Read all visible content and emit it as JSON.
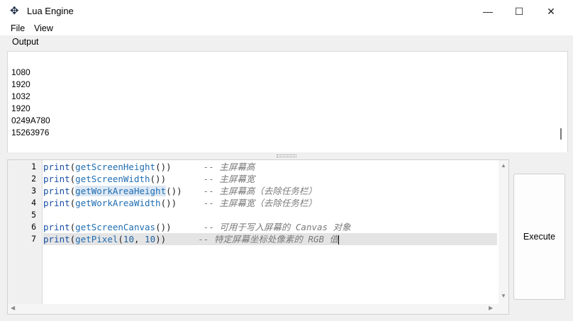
{
  "window": {
    "title": "Lua Engine",
    "minimize_glyph": "—",
    "maximize_glyph": "☐",
    "close_glyph": "✕"
  },
  "menu": {
    "file": "File",
    "view": "View"
  },
  "output": {
    "label": "Output",
    "lines": [
      "1080",
      "1920",
      "1032",
      "1920",
      "0249A780",
      "15263976"
    ]
  },
  "editor": {
    "line_numbers": [
      "1",
      "2",
      "3",
      "4",
      "5",
      "6",
      "7"
    ],
    "lines": [
      {
        "kw": "print",
        "fn": "getScreenHeight",
        "args": "",
        "pad": "      ",
        "comment": "-- 主屏幕高"
      },
      {
        "kw": "print",
        "fn": "getScreenWidth",
        "args": "",
        "pad": "       ",
        "comment": "-- 主屏幕宽"
      },
      {
        "kw": "print",
        "fn": "getWorkAreaHeight",
        "args": "",
        "pad": "    ",
        "comment": "-- 主屏幕高（去除任务栏）"
      },
      {
        "kw": "print",
        "fn": "getWorkAreaWidth",
        "args": "",
        "pad": "     ",
        "comment": "-- 主屏幕宽（去除任务栏）"
      },
      {
        "kw": "",
        "fn": "",
        "args": "",
        "pad": "",
        "comment": ""
      },
      {
        "kw": "print",
        "fn": "getScreenCanvas",
        "args": "",
        "pad": "      ",
        "comment": "-- 可用于写入屏幕的 Canvas 对象"
      },
      {
        "kw": "print",
        "fn": "getPixel",
        "args_a": "10",
        "args_sep": ", ",
        "args_b": "10",
        "pad": "      ",
        "comment": "-- 特定屏幕坐标处像素的 RGB 值"
      }
    ]
  },
  "execute_label": "Execute",
  "icons": {
    "app": "cheat-engine-icon",
    "scroll_up": "▲",
    "scroll_down": "▼",
    "scroll_left": "◀",
    "scroll_right": "▶"
  }
}
